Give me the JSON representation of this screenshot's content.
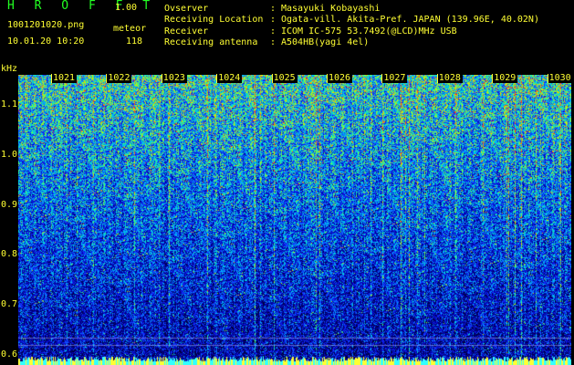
{
  "header": {
    "app_title": "H R O F F T",
    "version": "1.00",
    "filename": "1001201020.png",
    "mode": "meteor",
    "timestamp": "10.01.20 10:20",
    "count": "118"
  },
  "info": [
    {
      "label": "Ovserver",
      "sep": ":",
      "value": "Masayuki Kobayashi"
    },
    {
      "label": "Receiving Location",
      "sep": ":",
      "value": "Ogata-vill. Akita-Pref. JAPAN (139.96E, 40.02N)"
    },
    {
      "label": "Receiver",
      "sep": ":",
      "value": "ICOM IC-575 53.7492(@LCD)MHz USB"
    },
    {
      "label": "Receiving antenna",
      "sep": ":",
      "value": "A504HB(yagi 4el)"
    }
  ],
  "axis": {
    "unit": "kHz",
    "y_ticks": [
      "1.1",
      "1.0",
      "0.9",
      "0.8",
      "0.7",
      "0.6"
    ],
    "y_values": [
      1.1,
      1.0,
      0.9,
      0.8,
      0.7,
      0.6
    ],
    "y_range": [
      0.58,
      1.16
    ],
    "minute_ticks": [
      "1021",
      "1022",
      "1023",
      "1024",
      "1025",
      "1026",
      "1027",
      "1028",
      "1029",
      "1030"
    ]
  },
  "colors": {
    "label_yellow": "#ffff33",
    "title_green": "#22ff22",
    "background": "#000000"
  }
}
